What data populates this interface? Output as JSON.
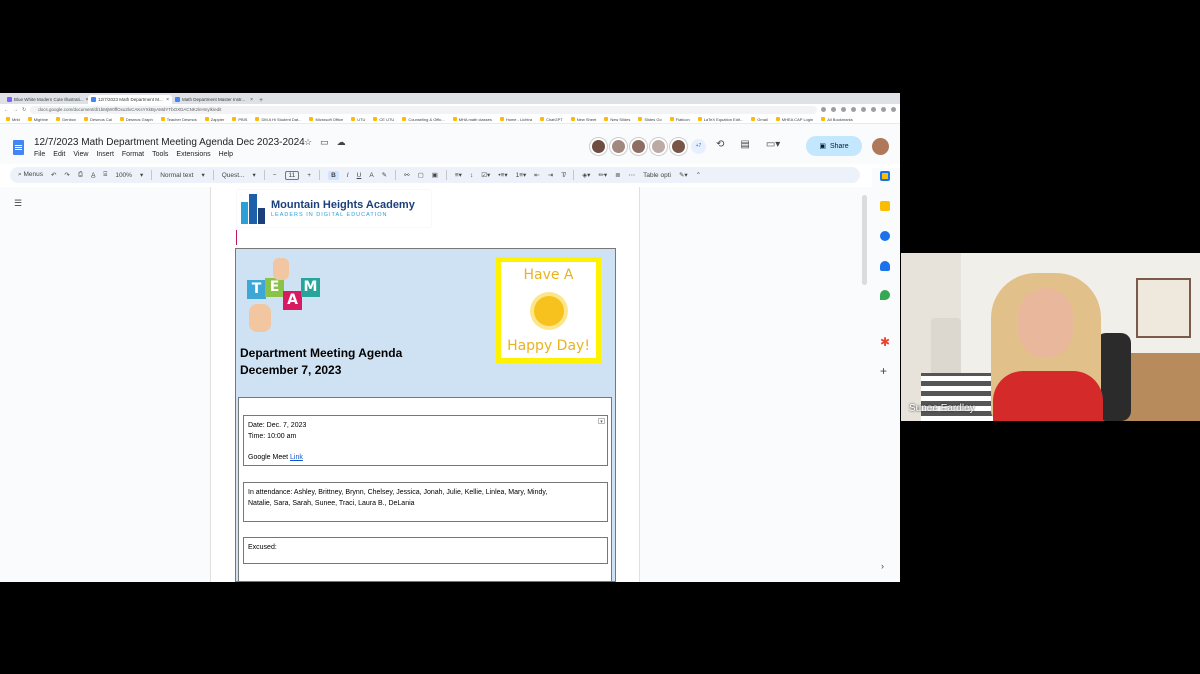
{
  "browser": {
    "tabs": [
      {
        "label": "Blue White Modern Cute Illustrati...",
        "active": false
      },
      {
        "label": "12/7/2023 Math Department M...",
        "active": true
      },
      {
        "label": "Math Department Master Instr...",
        "active": false
      }
    ],
    "url": "docs.google.com/document/d/1bMjW0ffOxu2lxCAKsYXkByAMdYTbOXDACNKzkHmylk/edit",
    "bookmarks": [
      "Mrkt",
      "Mightne",
      "Genbox",
      "Desmos Cal",
      "Desmos Graph",
      "Teacher Desmos",
      "Zappier",
      "PBIS",
      "DM A Hi Student Dat...",
      "Microsoft Office",
      "UTU",
      "CE UTU",
      "Counseling & Offic...",
      "MHA math classes",
      "Home - Lichtra",
      "ChatGPT",
      "New Sheet",
      "New Slides",
      "Slides Go",
      "Flaticon",
      "LaTeX Equation Edit...",
      "Gmail",
      "MHEA CAP Login",
      "All Bookmarks"
    ]
  },
  "doc": {
    "title": "12/7/2023 Math Department Meeting Agenda Dec  2023-2024",
    "menu": [
      "File",
      "Edit",
      "View",
      "Insert",
      "Format",
      "Tools",
      "Extensions",
      "Help"
    ],
    "collab_more": "+7",
    "share_label": "Share"
  },
  "toolbar": {
    "menus": "Menus",
    "zoom": "100%",
    "style": "Normal text",
    "font": "Quest...",
    "font_size": "11",
    "table_options": "Table opti"
  },
  "content": {
    "logo_name": "Mountain Heights Academy",
    "logo_tagline": "LEADERS IN DIGITAL EDUCATION",
    "team_letters": [
      "T",
      "E",
      "A",
      "M"
    ],
    "agenda_title": "Department Meeting Agenda",
    "agenda_date": "December 7, 2023",
    "happy_top": "Have A",
    "happy_bottom": "Happy Day!",
    "date_line": "Date: Dec. 7, 2023",
    "time_line": "Time: 10:00 am",
    "meet_prefix": "Google Meet ",
    "meet_link": "Link",
    "attendance_line1": "In attendance: Ashley,  Brittney,  Brynn,  Chelsey,  Jessica, Jonah,  Julie,  Kellie,  Linlea,  Mary,  Mindy,",
    "attendance_line2": "Natalie,  Sara,  Sarah,  Sunee, Traci, Laura B., DeLania",
    "excused": "Excused:"
  },
  "video": {
    "participant": "Sunee Eardley"
  },
  "colors": {
    "agenda_bg": "#cfe2f3",
    "share_bg": "#c2e7ff",
    "happy_border": "#fff200",
    "link": "#1155cc"
  }
}
